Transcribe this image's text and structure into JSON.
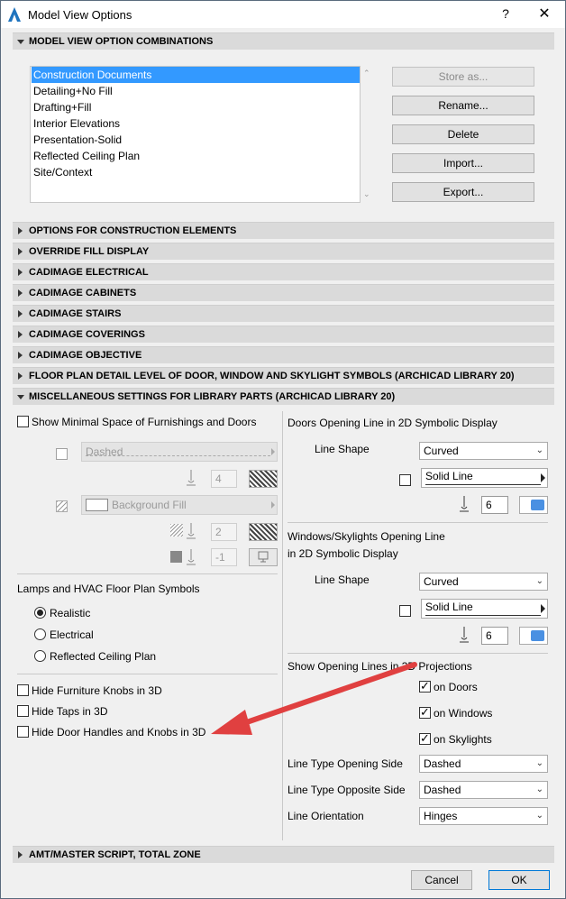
{
  "window": {
    "title": "Model View Options",
    "help": "?",
    "close": "✕"
  },
  "sections": {
    "combinations": "MODEL VIEW OPTION COMBINATIONS",
    "construction_elements": "OPTIONS FOR CONSTRUCTION ELEMENTS",
    "override_fill": "OVERRIDE FILL DISPLAY",
    "cad_electrical": "CADIMAGE ELECTRICAL",
    "cad_cabinets": "CADIMAGE CABINETS",
    "cad_stairs": "CADIMAGE STAIRS",
    "cad_coverings": "CADIMAGE COVERINGS",
    "cad_objective": "CADIMAGE OBJECTIVE",
    "floor_plan_detail": "FLOOR PLAN DETAIL LEVEL OF DOOR, WINDOW AND SKYLIGHT SYMBOLS (ARCHICAD LIBRARY 20)",
    "misc_settings": "MISCELLANEOUS SETTINGS FOR LIBRARY PARTS (ARCHICAD LIBRARY 20)",
    "amt": "AMT/MASTER SCRIPT, TOTAL ZONE"
  },
  "combinations": {
    "items": [
      "Construction Documents",
      "Detailing+No Fill",
      "Drafting+Fill",
      "Interior Elevations",
      "Presentation-Solid",
      "Reflected Ceiling Plan",
      "Site/Context"
    ],
    "selected_index": 0,
    "buttons": {
      "store_as": "Store as...",
      "rename": "Rename...",
      "delete": "Delete",
      "import": "Import...",
      "export": "Export..."
    }
  },
  "misc": {
    "show_minimal_space": "Show Minimal Space of Furnishings and Doors",
    "line_type_value": "Dashed",
    "pen_value_1": "4",
    "fill_value": "Background Fill",
    "pen_value_2": "2",
    "pen_value_3": "-1",
    "lamps_title": "Lamps and HVAC Floor Plan Symbols",
    "lamps_options": [
      "Realistic",
      "Electrical",
      "Reflected Ceiling Plan"
    ],
    "lamps_selected": "Realistic",
    "hide_knobs": "Hide Furniture Knobs in 3D",
    "hide_taps": "Hide Taps in 3D",
    "hide_handles": "Hide Door Handles and Knobs in 3D",
    "doors_title": "Doors Opening Line in 2D Symbolic Display",
    "line_shape_label": "Line Shape",
    "doors_line_shape": "Curved",
    "doors_line_type": "Solid Line",
    "doors_pen": "6",
    "windows_title_1": "Windows/Skylights Opening Line",
    "windows_title_2": "in 2D Symbolic Display",
    "windows_line_shape": "Curved",
    "windows_line_type": "Solid Line",
    "windows_pen": "6",
    "show_opening_title": "Show Opening Lines in 3D Projections",
    "on_doors": "on Doors",
    "on_windows": "on Windows",
    "on_skylights": "on Skylights",
    "lt_opening_label": "Line Type Opening Side",
    "lt_opening_value": "Dashed",
    "lt_opposite_label": "Line Type Opposite Side",
    "lt_opposite_value": "Dashed",
    "orientation_label": "Line Orientation",
    "orientation_value": "Hinges"
  },
  "footer": {
    "cancel": "Cancel",
    "ok": "OK"
  },
  "colors": {
    "selection": "#3399ff",
    "arrow": "#e04040",
    "pen_blue": "#4a90e2"
  }
}
